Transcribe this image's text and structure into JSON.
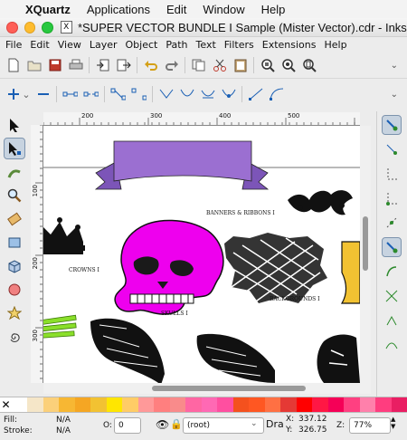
{
  "mac_menu": {
    "app": "XQuartz",
    "items": [
      "Applications",
      "Edit",
      "Window",
      "Help"
    ]
  },
  "window": {
    "title": "*SUPER VECTOR BUNDLE I Sample (Mister Vector).cdr - Inksc..."
  },
  "menu": [
    "File",
    "Edit",
    "View",
    "Layer",
    "Object",
    "Path",
    "Text",
    "Filters",
    "Extensions",
    "Help"
  ],
  "toolbar1": [
    "new-icon",
    "open-icon",
    "save-icon",
    "print-icon",
    "import-icon",
    "export-icon",
    "undo-icon",
    "redo-icon",
    "copy-icon",
    "cut-icon",
    "paste-icon",
    "zoom-selection-icon",
    "zoom-drawing-icon",
    "zoom-page-icon"
  ],
  "toolbar2": [
    "add-node-icon",
    "delete-node-icon",
    "join-nodes-icon",
    "break-path-icon",
    "join-segment-icon",
    "delete-segment-icon",
    "cusp-node-icon",
    "smooth-node-icon",
    "symmetric-node-icon",
    "auto-smooth-icon",
    "to-line-icon",
    "to-curve-icon"
  ],
  "ruler": {
    "h_labels": [
      "200",
      "300",
      "400",
      "500"
    ],
    "v_labels": [
      "100",
      "200",
      "300"
    ]
  },
  "canvas": {
    "labels": {
      "banners": "BANNERS & RIBBONS I",
      "crowns": "CROWNS I",
      "skulls": "SKULLS I",
      "backgrounds": "BACKGROUNDS I"
    },
    "colors": {
      "ribbon": "#9b6fd1",
      "skull": "#ee00ee",
      "green": "#8adf2a",
      "gold": "#f2c232"
    }
  },
  "palette": [
    "#ffffff",
    "#f5e6c8",
    "#fbd07a",
    "#f7b733",
    "#f5a623",
    "#f2c232",
    "#ffe600",
    "#ffcc66",
    "#ff9999",
    "#ff7f7f",
    "#f98b8b",
    "#ff66a3",
    "#ff69b4",
    "#ff4fa0",
    "#f4511e",
    "#ff5722",
    "#ff7043",
    "#e53935",
    "#ff0000",
    "#ff1744",
    "#f50057",
    "#ff4081",
    "#ff80ab",
    "#ff3d7f",
    "#e91e63"
  ],
  "status": {
    "fill_label": "Fill:",
    "fill_value": "N/A",
    "stroke_label": "Stroke:",
    "stroke_value": "N/A",
    "opacity_label": "O:",
    "opacity_value": "0",
    "layer": "(root)",
    "tool_short": "Dra",
    "x_label": "X:",
    "x_value": "337.12",
    "y_label": "Y:",
    "y_value": "326.75",
    "zoom_label": "Z:",
    "zoom_value": "77%"
  }
}
